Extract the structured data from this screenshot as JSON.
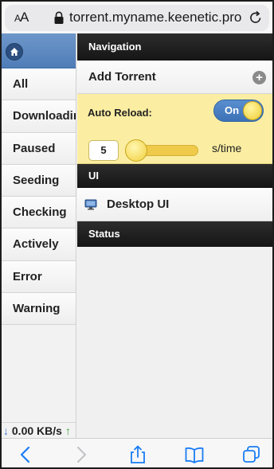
{
  "browser": {
    "text_size_label": "AA",
    "url": "torrent.myname.keenetic.pro",
    "icons": {
      "lock": "lock-icon",
      "reload": "reload-icon"
    }
  },
  "sidebar": {
    "home_icon": "home-icon",
    "items": [
      {
        "label": "All"
      },
      {
        "label": "Downloading"
      },
      {
        "label": "Paused"
      },
      {
        "label": "Seeding"
      },
      {
        "label": "Checking"
      },
      {
        "label": "Actively"
      },
      {
        "label": "Error"
      },
      {
        "label": "Warning"
      }
    ],
    "speed": {
      "download_arrow": "↓",
      "value": "0.00 KB/s",
      "upload_arrow": "↑"
    }
  },
  "navigation": {
    "header": "Navigation",
    "add_torrent": "Add Torrent",
    "auto_reload": {
      "label": "Auto Reload:",
      "toggle": "On",
      "interval": "5",
      "unit": "s/time"
    }
  },
  "ui_section": {
    "header": "UI",
    "desktop_ui": "Desktop UI"
  },
  "status_section": {
    "header": "Status"
  },
  "toolbar": {
    "icons": [
      "back-icon",
      "forward-icon",
      "share-icon",
      "bookmarks-icon",
      "tabs-icon"
    ]
  },
  "colors": {
    "accent_blue": "#4f7db8",
    "reload_panel": "#fbeea2",
    "ios_blue": "#1a7cf5"
  }
}
